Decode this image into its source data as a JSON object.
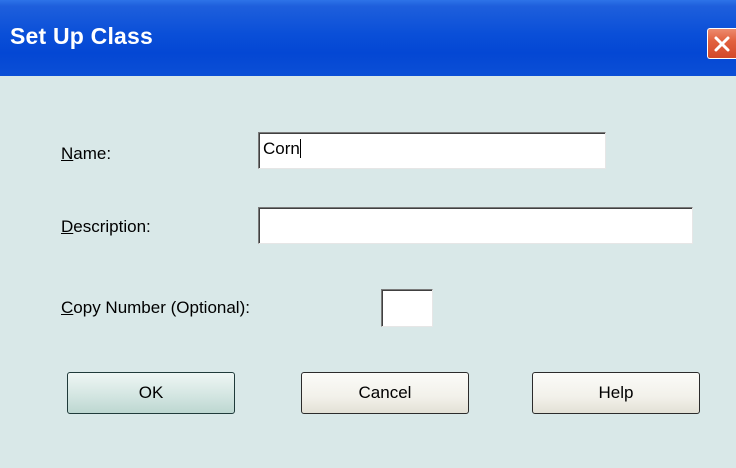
{
  "window": {
    "title": "Set Up Class",
    "close_icon": "close-icon"
  },
  "form": {
    "name_label_key": "N",
    "name_label_rest": "ame:",
    "name_value": "Corn",
    "description_label_key": "D",
    "description_label_rest": "escription:",
    "description_value": "",
    "copy_label_key": "C",
    "copy_label_rest": "opy Number (Optional):",
    "copy_value": ""
  },
  "buttons": {
    "ok_label": "OK",
    "cancel_label": "Cancel",
    "help_label": "Help"
  },
  "colors": {
    "titlebar": "#0a4fd8",
    "body": "#d9e8e8",
    "close": "#d2482a"
  }
}
